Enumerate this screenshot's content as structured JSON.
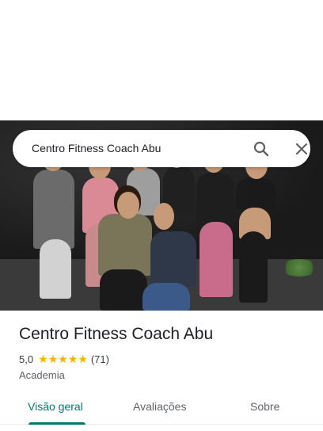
{
  "search": {
    "query": "Centro Fitness Coach Abu"
  },
  "place": {
    "name": "Centro Fitness Coach Abu",
    "rating": "5,0",
    "stars": "★★★★★",
    "reviews": "(71)",
    "category": "Academia"
  },
  "tabs": [
    {
      "label": "Visão geral",
      "active": true
    },
    {
      "label": "Avaliações",
      "active": false
    },
    {
      "label": "Sobre",
      "active": false
    }
  ],
  "colors": {
    "accent": "#00796b",
    "star": "#f8b400"
  }
}
